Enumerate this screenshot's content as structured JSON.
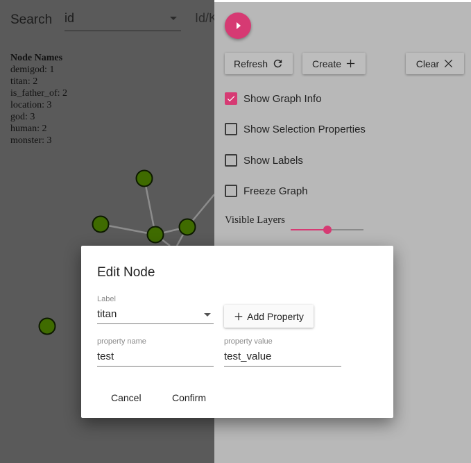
{
  "search": {
    "label": "Search",
    "field_value": "id",
    "second_field_value": "Id/K"
  },
  "graph_info": {
    "title": "Node Names",
    "entries": [
      "demigod: 1",
      "titan: 2",
      "is_father_of: 2",
      "location: 3",
      "god: 3",
      "human: 2",
      "monster: 3"
    ]
  },
  "panel": {
    "fab_icon": "play-arrow-icon",
    "buttons": {
      "refresh": "Refresh",
      "create": "Create",
      "clear": "Clear"
    },
    "options": {
      "show_graph_info": "Show Graph Info",
      "show_selection_properties": "Show Selection Properties",
      "show_labels": "Show Labels",
      "freeze_graph": "Freeze Graph"
    },
    "visible_layers_label": "Visible Layers",
    "visible_layers_level": 0.5
  },
  "colors": {
    "accent": "#d63a73",
    "node_fill": "#3f6b00",
    "panel_bg": "#b8b8b8",
    "graph_bg": "#5a5a5a"
  },
  "dialog": {
    "title": "Edit Node",
    "label_caption": "Label",
    "label_value": "titan",
    "add_property": "Add Property",
    "property_name_caption": "property name",
    "property_name_value": "test",
    "property_value_caption": "property value",
    "property_value_value": "test_value",
    "cancel": "Cancel",
    "confirm": "Confirm"
  }
}
